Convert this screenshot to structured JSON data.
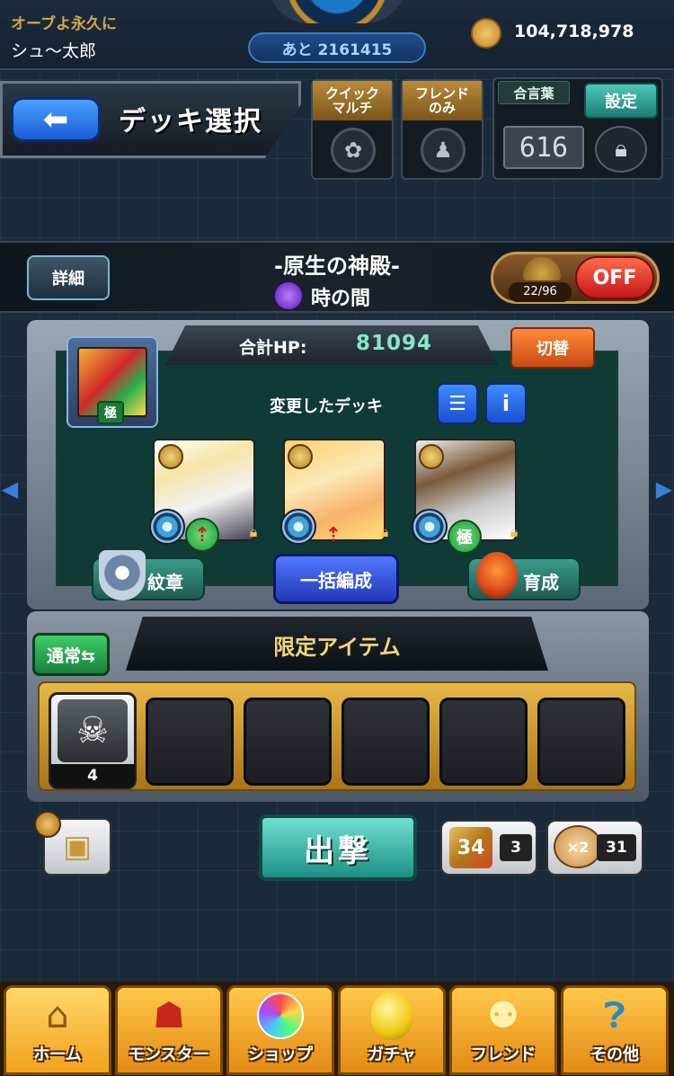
{
  "header": {
    "orb_label": "オーブよ永久に",
    "player_name": "シュ〜太郎",
    "remaining": "あと 2161415",
    "coins": "104,718,978"
  },
  "title": {
    "back_icon": "back-arrow-icon",
    "page_title": "デッキ選択"
  },
  "modes": {
    "quick_multi": "クイック\nマルチ",
    "friend_only": "フレンドのみ",
    "passcode_label": "合言葉",
    "settings": "設定",
    "passcode_value": "616"
  },
  "quest": {
    "detail": "詳細",
    "name": "-原生の神殿-",
    "stage": "時の間",
    "stamina_count": "22/96",
    "off_label": "OFF"
  },
  "deck": {
    "hp_label": "合計HP:",
    "hp_value": "81094",
    "switch_label": "切替",
    "deck_name": "変更したデッキ",
    "leader_badge": "極",
    "char3_badge": "極",
    "crest_label": "紋章",
    "bulk_label": "一括編成",
    "train_label": "育成"
  },
  "items": {
    "normal_label": "通常⇆",
    "title": "限定アイテム",
    "first_item_count": "4"
  },
  "actions": {
    "sortie_label": "出撃",
    "dice_count": "3",
    "dice_icon_text": "34",
    "boost_icon_text": "×2",
    "boost_count": "31"
  },
  "nav": [
    {
      "label": "ホーム",
      "icon": "home-icon"
    },
    {
      "label": "モンスター",
      "icon": "monster-icon"
    },
    {
      "label": "ショップ",
      "icon": "shop-orb-icon"
    },
    {
      "label": "ガチャ",
      "icon": "gacha-egg-icon"
    },
    {
      "label": "フレンド",
      "icon": "friend-icon"
    },
    {
      "label": "その他",
      "icon": "other-icon"
    }
  ],
  "colors": {
    "accent_blue": "#1a5cd6",
    "hp_green": "#86e8c6",
    "gold": "#f4d67a",
    "off_red": "#c4161a"
  }
}
